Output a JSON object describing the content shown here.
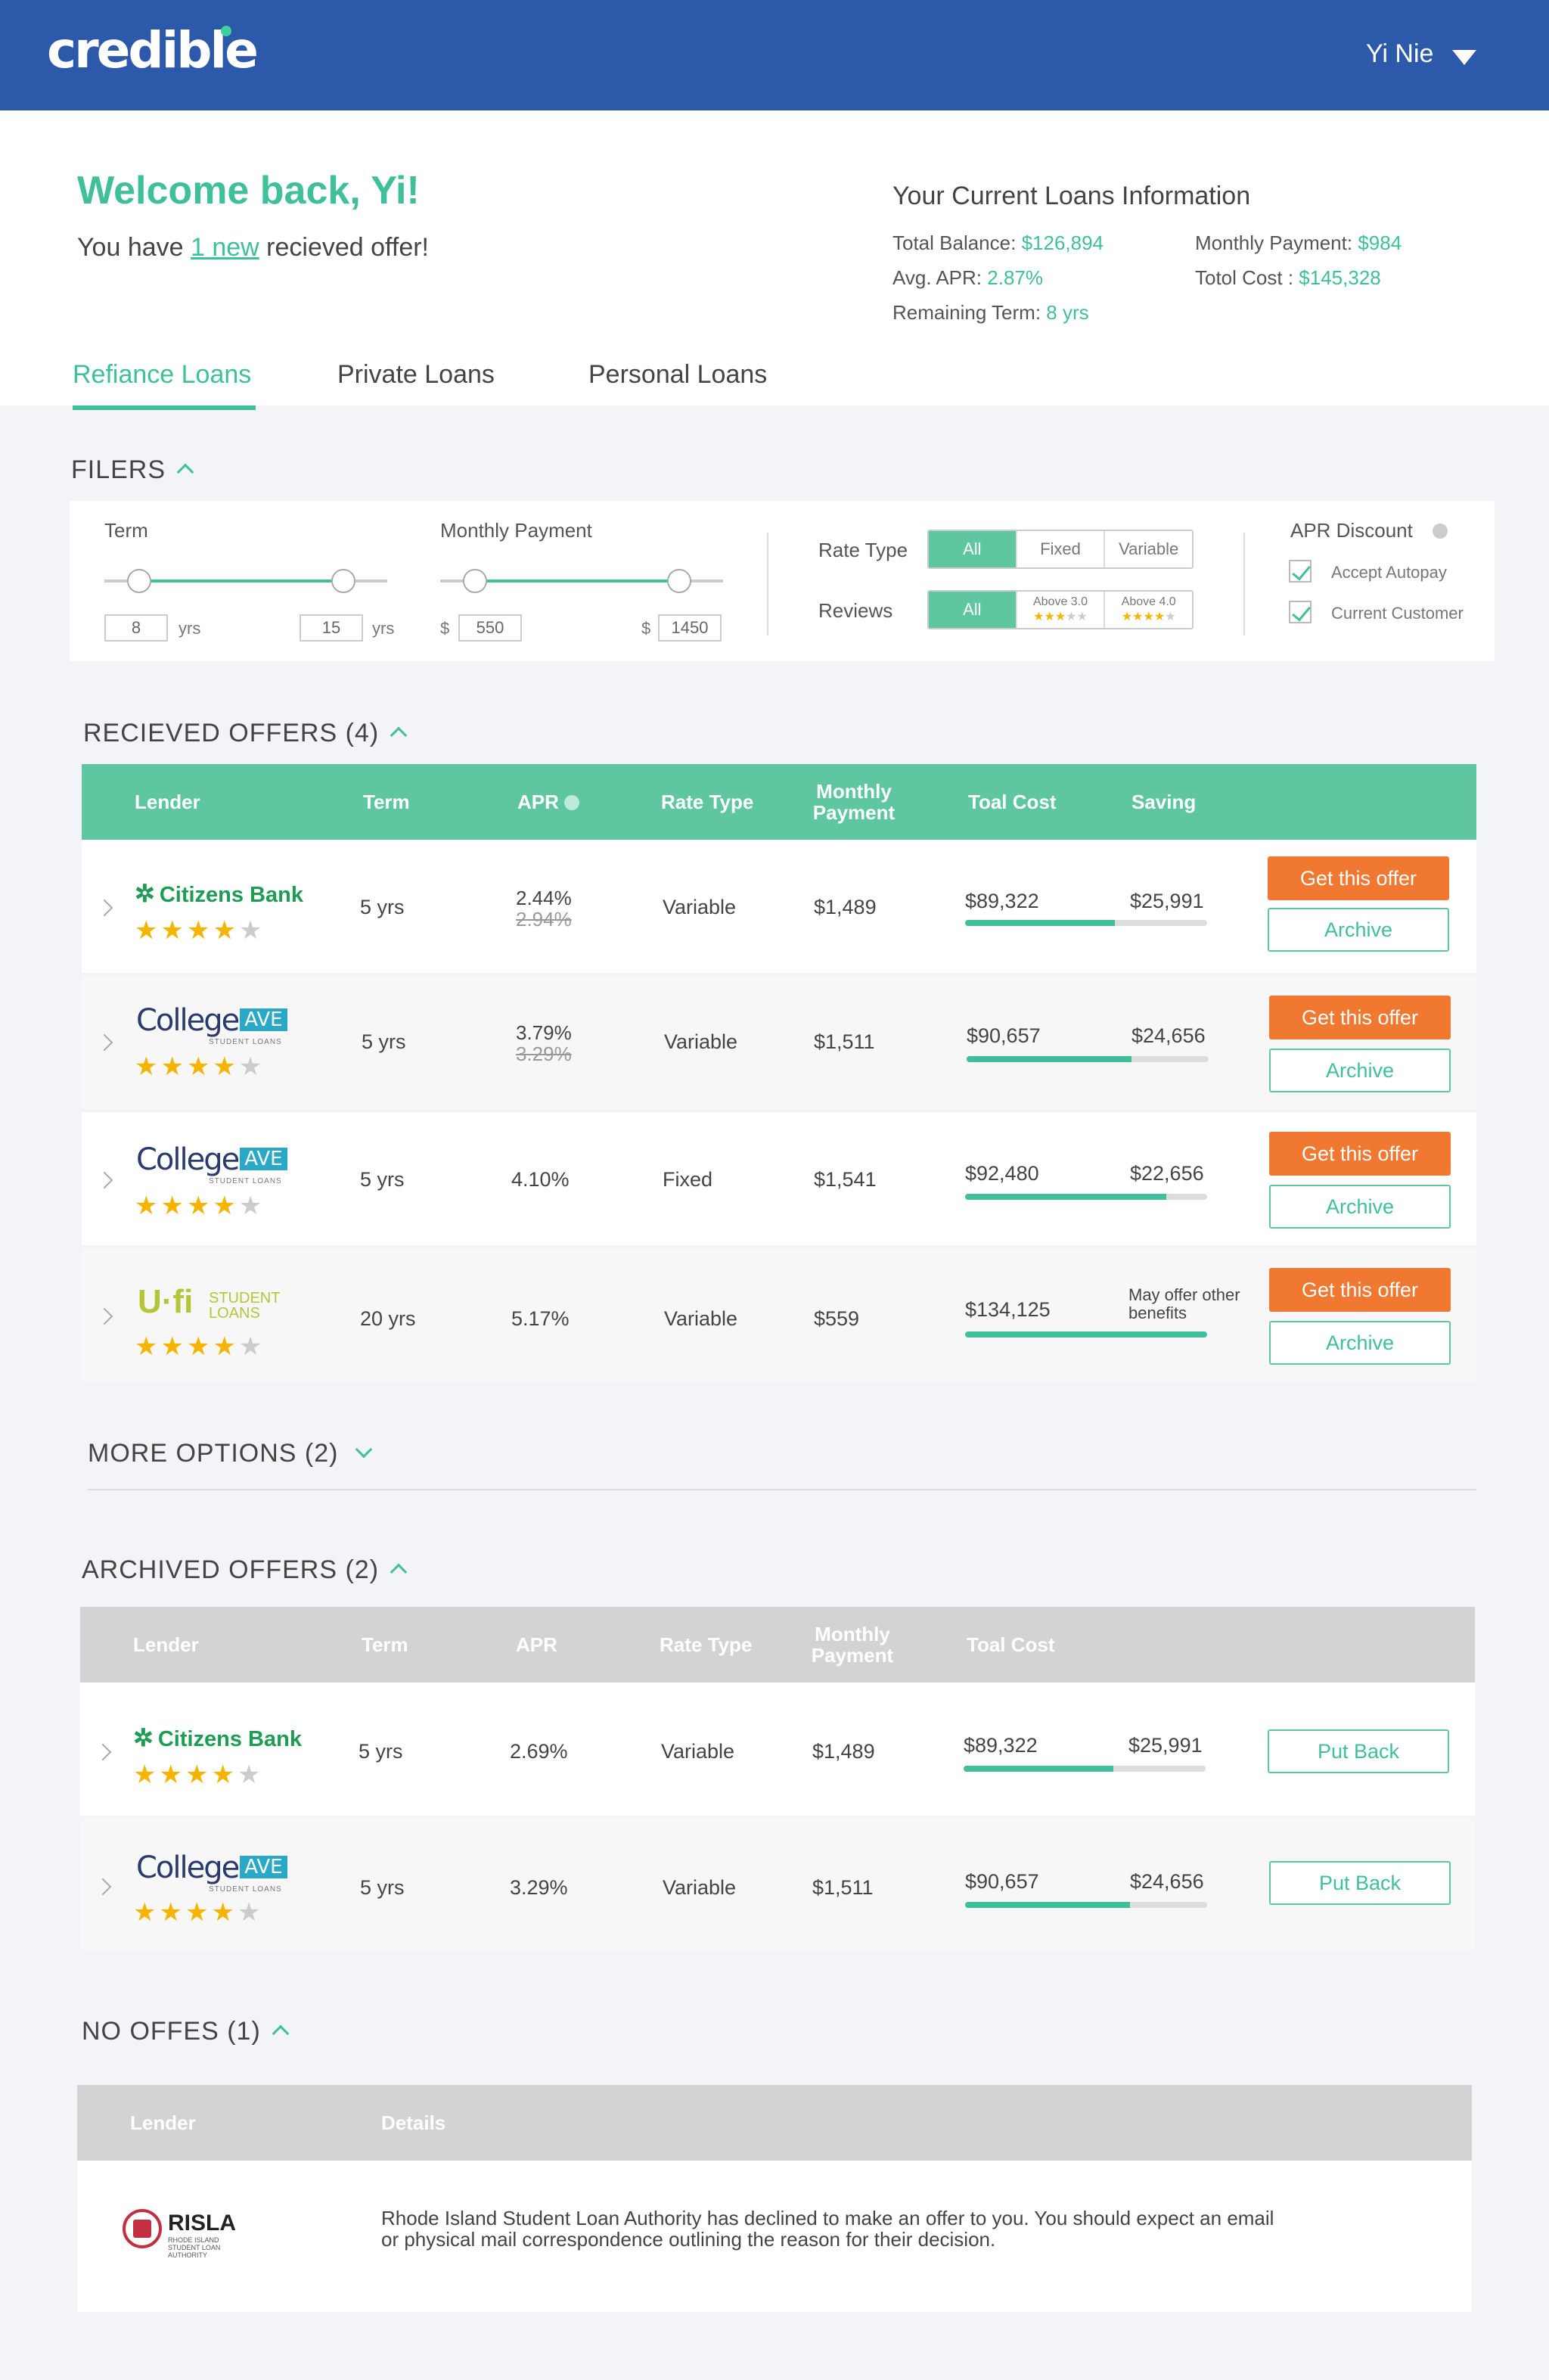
{
  "header": {
    "logo": "credible",
    "user_name": "Yi Nie"
  },
  "welcome": {
    "title": "Welcome back, Yi!",
    "line_prefix": "You have ",
    "line_link": "1 new",
    "line_suffix": " recieved offer!"
  },
  "current_loans": {
    "title": "Your Current Loans Information",
    "total_balance_label": "Total Balance:",
    "total_balance": "$126,894",
    "avg_apr_label": "Avg. APR:",
    "avg_apr": "2.87%",
    "remaining_term_label": "Remaining Term:",
    "remaining_term": "8 yrs",
    "monthly_payment_label": "Monthly Payment:",
    "monthly_payment": "$984",
    "total_cost_label": "Totol Cost :",
    "total_cost": "$145,328"
  },
  "tabs": [
    {
      "label": "Refiance Loans"
    },
    {
      "label": "Private Loans"
    },
    {
      "label": "Personal Loans"
    }
  ],
  "filters": {
    "title": "FILERS",
    "term": {
      "label": "Term",
      "min": "8",
      "max": "15",
      "unit": "yrs"
    },
    "monthly": {
      "label": "Monthly Payment",
      "min": "550",
      "max": "1450",
      "currency": "$"
    },
    "rate_type": {
      "label": "Rate Type",
      "options": [
        "All",
        "Fixed",
        "Variable"
      ],
      "selected": "All"
    },
    "reviews": {
      "label": "Reviews",
      "options": [
        "All",
        "Above 3.0",
        "Above 4.0"
      ],
      "selected": "All"
    },
    "apr_discount": {
      "label": "APR Discount",
      "options": [
        "Accept Autopay",
        "Current Customer"
      ]
    }
  },
  "received": {
    "title": "RECIEVED OFFERS (4)",
    "headers": [
      "Lender",
      "Term",
      "APR",
      "Rate Type",
      "Monthly Payment",
      "Toal Cost",
      "Saving"
    ],
    "rows": [
      {
        "lender": "Citizens Bank",
        "stars": 4,
        "term": "5 yrs",
        "apr": "2.44%",
        "apr_old": "2.94%",
        "rate": "Variable",
        "monthly": "$1,489",
        "cost": "$89,322",
        "saving": "$25,991",
        "progress": 0.62,
        "btn1": "Get this offer",
        "btn2": "Archive"
      },
      {
        "lender": "College AVE",
        "stars": 4,
        "term": "5 yrs",
        "apr": "3.79%",
        "apr_old": "3.29%",
        "rate": "Variable",
        "monthly": "$1,511",
        "cost": "$90,657",
        "saving": "$24,656",
        "progress": 0.68,
        "btn1": "Get this offer",
        "btn2": "Archive"
      },
      {
        "lender": "College AVE",
        "stars": 4,
        "term": "5 yrs",
        "apr": "4.10%",
        "rate": "Fixed",
        "monthly": "$1,541",
        "cost": "$92,480",
        "saving": "$22,656",
        "progress": 0.83,
        "btn1": "Get this offer",
        "btn2": "Archive"
      },
      {
        "lender": "U-fi Student Loans",
        "stars": 4,
        "term": "20 yrs",
        "apr": "5.17%",
        "rate": "Variable",
        "monthly": "$559",
        "cost": "$134,125",
        "saving": "May offer other benefits",
        "progress": 1.0,
        "btn1": "Get this offer",
        "btn2": "Archive"
      }
    ]
  },
  "more_options": {
    "title": "MORE OPTIONS (2)"
  },
  "archived": {
    "title": "ARCHIVED OFFERS (2)",
    "headers": [
      "Lender",
      "Term",
      "APR",
      "Rate Type",
      "Monthly Payment",
      "Toal Cost"
    ],
    "rows": [
      {
        "lender": "Citizens Bank",
        "stars": 4,
        "term": "5 yrs",
        "apr": "2.69%",
        "rate": "Variable",
        "monthly": "$1,489",
        "cost": "$89,322",
        "saving": "$25,991",
        "progress": 0.62,
        "btn": "Put Back"
      },
      {
        "lender": "College AVE",
        "stars": 4,
        "term": "5 yrs",
        "apr": "3.29%",
        "rate": "Variable",
        "monthly": "$1,511",
        "cost": "$90,657",
        "saving": "$24,656",
        "progress": 0.68,
        "btn": "Put Back"
      }
    ]
  },
  "no_offers": {
    "title": "NO OFFES (1)",
    "headers": [
      "Lender",
      "Details"
    ],
    "lender": "RISLA",
    "lender_sub": "RHODE ISLAND STUDENT LOAN AUTHORITY",
    "details": "Rhode Island Student Loan Authority has declined to make an offer to you. You should expect an email or physical mail correspondence outlining the reason for their decision."
  },
  "colors": {
    "brand_blue": "#2c59a9",
    "accent_green": "#3fbf9a",
    "orange": "#f07830"
  }
}
